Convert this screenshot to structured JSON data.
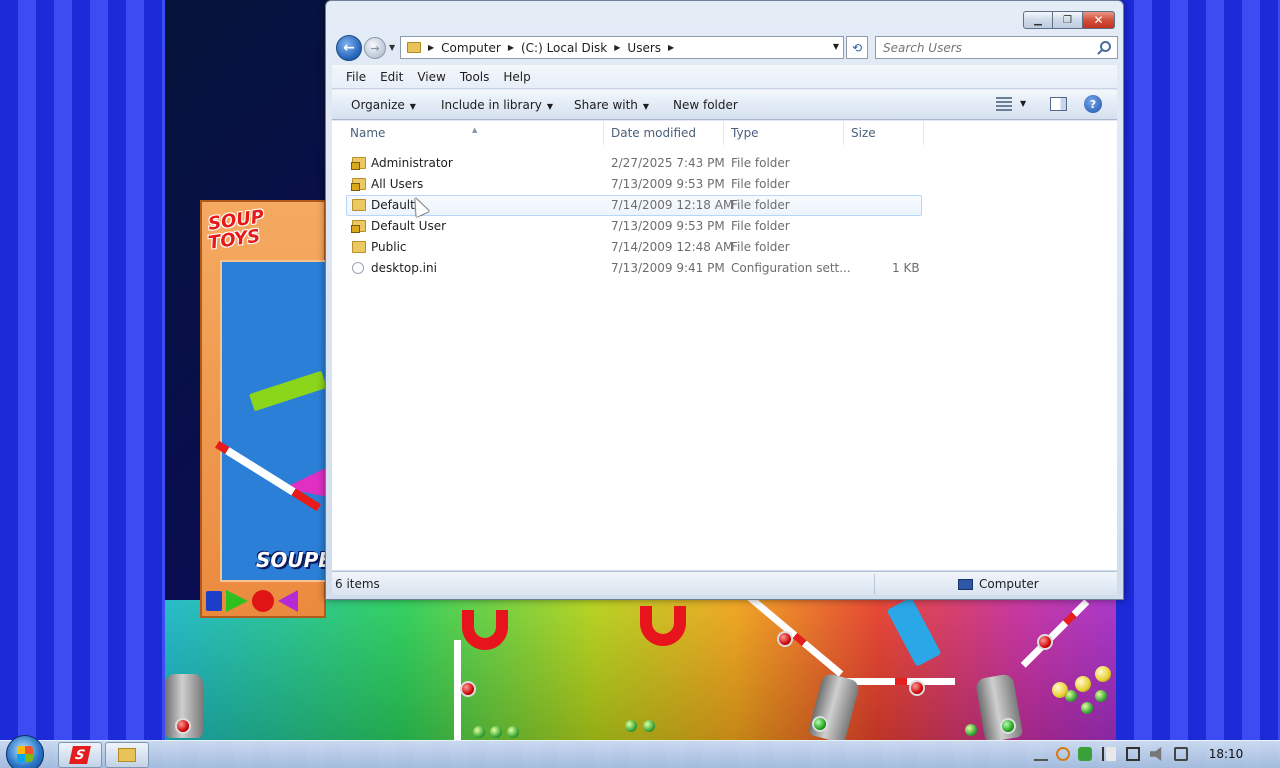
{
  "window": {
    "address": {
      "crumbs": [
        "Computer",
        "(C:) Local Disk",
        "Users"
      ]
    },
    "search": {
      "placeholder": "Search Users"
    },
    "menu": [
      "File",
      "Edit",
      "View",
      "Tools",
      "Help"
    ],
    "commands": {
      "organize": "Organize",
      "include_in_library": "Include in library",
      "share_with": "Share with",
      "new_folder": "New folder"
    },
    "columns": {
      "name": "Name",
      "date_modified": "Date modified",
      "type": "Type",
      "size": "Size"
    },
    "files": [
      {
        "name": "Administrator",
        "date": "2/27/2025 7:43 PM",
        "type": "File folder",
        "size": "",
        "icon": "locked-folder-icon"
      },
      {
        "name": "All Users",
        "date": "7/13/2009 9:53 PM",
        "type": "File folder",
        "size": "",
        "icon": "locked-folder-icon"
      },
      {
        "name": "Default",
        "date": "7/14/2009 12:18 AM",
        "type": "File folder",
        "size": "",
        "icon": "folder-icon"
      },
      {
        "name": "Default User",
        "date": "7/13/2009 9:53 PM",
        "type": "File folder",
        "size": "",
        "icon": "locked-folder-icon"
      },
      {
        "name": "Public",
        "date": "7/14/2009 12:48 AM",
        "type": "File folder",
        "size": "",
        "icon": "folder-icon"
      },
      {
        "name": "desktop.ini",
        "date": "7/13/2009 9:41 PM",
        "type": "Configuration sett...",
        "size": "1 KB",
        "icon": "settings-file-icon"
      }
    ],
    "status": {
      "item_count": "6 items",
      "location": "Computer"
    }
  },
  "game": {
    "logo_line1": "SOUP",
    "logo_line2": "TOYS",
    "wordmark": "SOUPER"
  },
  "taskbar": {
    "clock": "18:10"
  },
  "colors": {
    "desktop_stripe_a": "#1c2ad8",
    "desktop_stripe_b": "#3d4cf2",
    "selection_border": "#b8d6fb",
    "close_button": "#c2321e"
  }
}
